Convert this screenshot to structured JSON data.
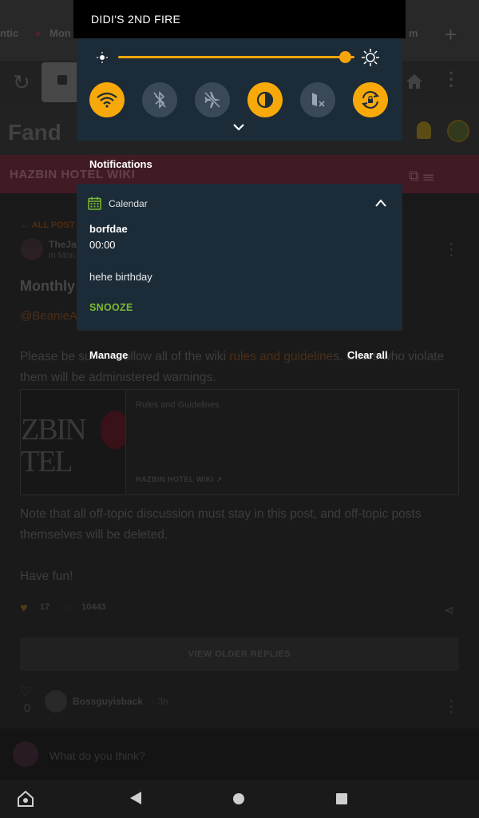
{
  "status": {
    "device_name": "DIDI'S 2ND FIRE",
    "brightness": 0.96
  },
  "quick_settings": [
    {
      "name": "wifi",
      "icon": "wifi-icon",
      "on": true
    },
    {
      "name": "bluetooth",
      "icon": "bluetooth-off-icon",
      "on": false
    },
    {
      "name": "airplane-mode",
      "icon": "airplane-off-icon",
      "on": false
    },
    {
      "name": "blue-shade",
      "icon": "contrast-icon",
      "on": true
    },
    {
      "name": "do-not-disturb",
      "icon": "dnd-off-icon",
      "on": false
    },
    {
      "name": "auto-rotate",
      "icon": "rotate-icon",
      "on": true
    }
  ],
  "notifications": {
    "heading": "Notifications",
    "card": {
      "app": "Calendar",
      "title": "borfdae",
      "time": "00:00",
      "body": "hehe birthday",
      "action": "SNOOZE"
    },
    "manage_label": "Manage",
    "clear_all_label": "Clear all"
  },
  "colors": {
    "accent": "#f7a90a",
    "panel": "#1c2b38",
    "snooze": "#7cbb2e"
  },
  "background": {
    "tabs": [
      "ntic",
      "Mon",
      "m"
    ],
    "fandom_logo": "Fand",
    "wiki_title": "HAZBIN HOTEL WIKI",
    "all_posts": "ALL POST",
    "author": "TheJa",
    "author_sub": "in Mon",
    "post_title": "Monthly",
    "mention": "@BeanieA",
    "para1_a": "Please be su",
    "para1_b": "ollow all of the wiki ",
    "para1_link": "rules and guideline",
    "para1_c": "s. Users who violate them will be administered warnings.",
    "embed": {
      "logo_line1": "ZBIN",
      "logo_line2": "TEL",
      "title": "Rules and Guidelines",
      "source": "HAZBIN HOTEL WIKI"
    },
    "para2": "Note that all off-topic discussion must stay in this post, and off-topic posts themselves will be deleted.",
    "para3": "Have fun!",
    "likes": "17",
    "comments": "10443",
    "view_older": "VIEW OLDER REPLIES",
    "reply_likes": "0",
    "reply_user": "Bossguyisback",
    "reply_time": "· 3h",
    "comment_placeholder": "What do you think?"
  }
}
